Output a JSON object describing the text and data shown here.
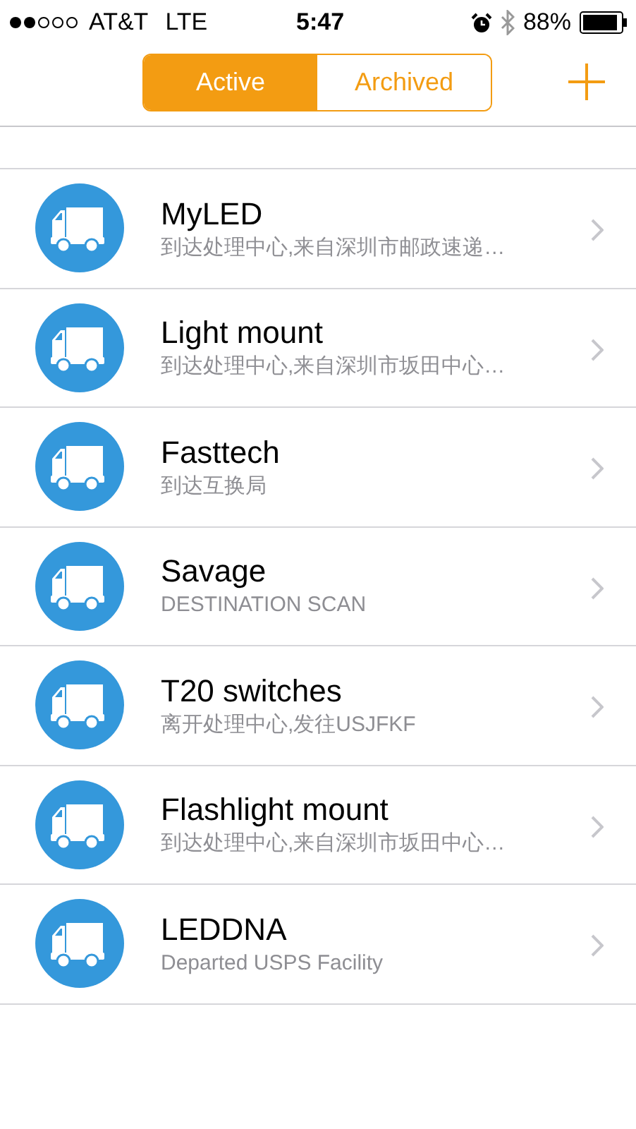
{
  "status_bar": {
    "carrier": "AT&T",
    "network": "LTE",
    "time": "5:47",
    "battery": "88%"
  },
  "tabs": [
    {
      "label": "Active",
      "selected": true
    },
    {
      "label": "Archived",
      "selected": false
    }
  ],
  "shipments": [
    {
      "title": "MyLED",
      "status": "到达处理中心,来自深圳市邮政速递…"
    },
    {
      "title": "Light mount",
      "status": "到达处理中心,来自深圳市坂田中心…"
    },
    {
      "title": "Fasttech",
      "status": "到达互换局"
    },
    {
      "title": "Savage",
      "status": "DESTINATION SCAN"
    },
    {
      "title": "T20 switches",
      "status": "离开处理中心,发往USJFKF"
    },
    {
      "title": "Flashlight mount",
      "status": "到达处理中心,来自深圳市坂田中心…"
    },
    {
      "title": "LEDDNA",
      "status": "Departed USPS Facility"
    }
  ]
}
